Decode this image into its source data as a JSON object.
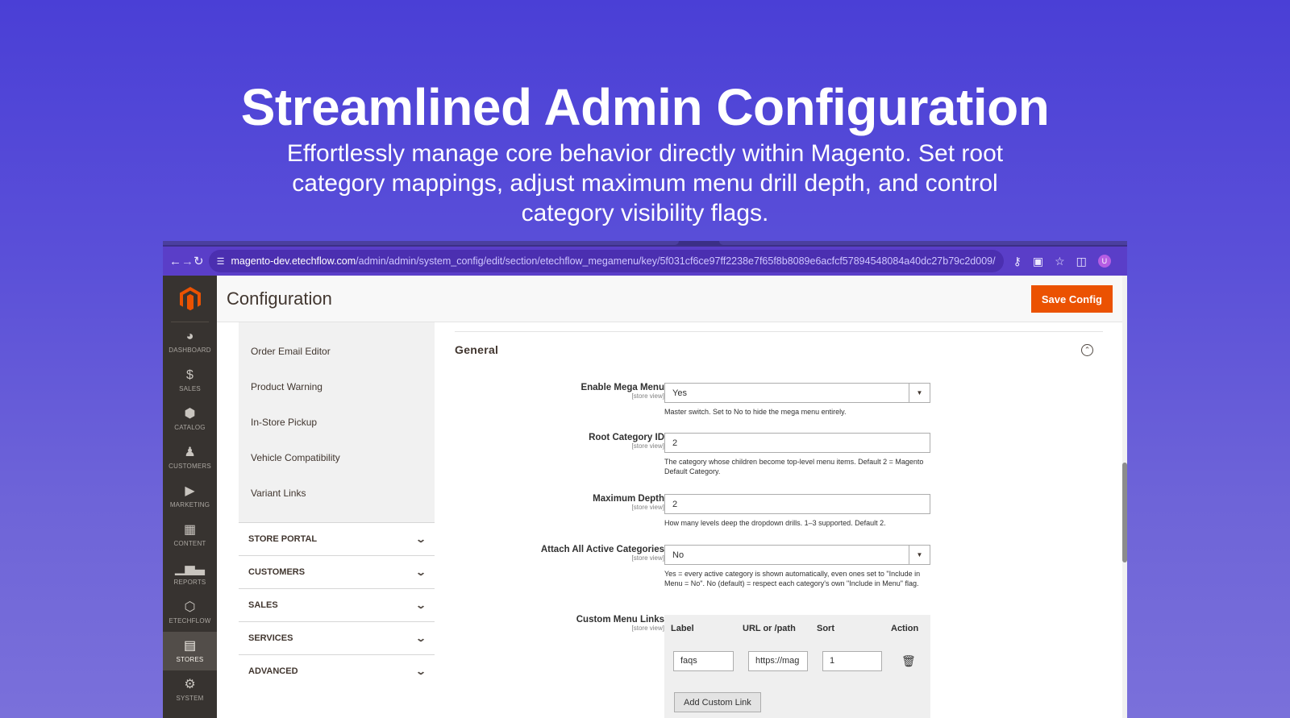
{
  "hero": {
    "title": "Streamlined Admin Configuration",
    "subtitle": "Effortlessly manage core behavior directly within Magento. Set root category mappings, adjust maximum menu drill depth, and control category visibility flags."
  },
  "browser": {
    "url_host": "magento-dev.etechflow.com",
    "url_path": "/admin/admin/system_config/edit/section/etechflow_megamenu/key/5f031cf6ce97ff2238e7f65f8b8089e6acfcf57894548084a40dc27b79c2d009/",
    "avatar_letter": "U"
  },
  "sidebar": {
    "items": [
      {
        "label": "DASHBOARD",
        "icon": "dashboard-icon"
      },
      {
        "label": "SALES",
        "icon": "dollar-icon"
      },
      {
        "label": "CATALOG",
        "icon": "box-icon"
      },
      {
        "label": "CUSTOMERS",
        "icon": "person-icon"
      },
      {
        "label": "MARKETING",
        "icon": "megaphone-icon"
      },
      {
        "label": "CONTENT",
        "icon": "content-icon"
      },
      {
        "label": "REPORTS",
        "icon": "bar-chart-icon"
      },
      {
        "label": "ETECHFLOW",
        "icon": "hexagon-icon"
      },
      {
        "label": "STORES",
        "icon": "store-icon"
      },
      {
        "label": "SYSTEM",
        "icon": "gear-icon"
      }
    ]
  },
  "header": {
    "title": "Configuration",
    "save_label": "Save Config"
  },
  "tabs": {
    "links": [
      "Order Email Editor",
      "Product Warning",
      "In-Store Pickup",
      "Vehicle Compatibility",
      "Variant Links"
    ],
    "groups": [
      "STORE PORTAL",
      "CUSTOMERS",
      "SALES",
      "SERVICES",
      "ADVANCED"
    ]
  },
  "section": {
    "title": "General",
    "scope": "[store view]",
    "enable": {
      "label": "Enable Mega Menu",
      "value": "Yes",
      "note": "Master switch. Set to No to hide the mega menu entirely."
    },
    "root": {
      "label": "Root Category ID",
      "value": "2",
      "note": "The category whose children become top-level menu items. Default 2 = Magento Default Category."
    },
    "depth": {
      "label": "Maximum Depth",
      "value": "2",
      "note": "How many levels deep the dropdown drills. 1–3 supported. Default 2."
    },
    "attach": {
      "label": "Attach All Active Categories",
      "value": "No",
      "note": "Yes = every active category is shown automatically, even ones set to \"Include in Menu = No\". No (default) = respect each category's own \"Include in Menu\" flag."
    },
    "links": {
      "label": "Custom Menu Links",
      "headers": [
        "Label",
        "URL or /path",
        "Sort",
        "Action"
      ],
      "row": {
        "label": "faqs",
        "url": "https://mag",
        "sort": "1"
      },
      "add_label": "Add Custom Link"
    }
  }
}
